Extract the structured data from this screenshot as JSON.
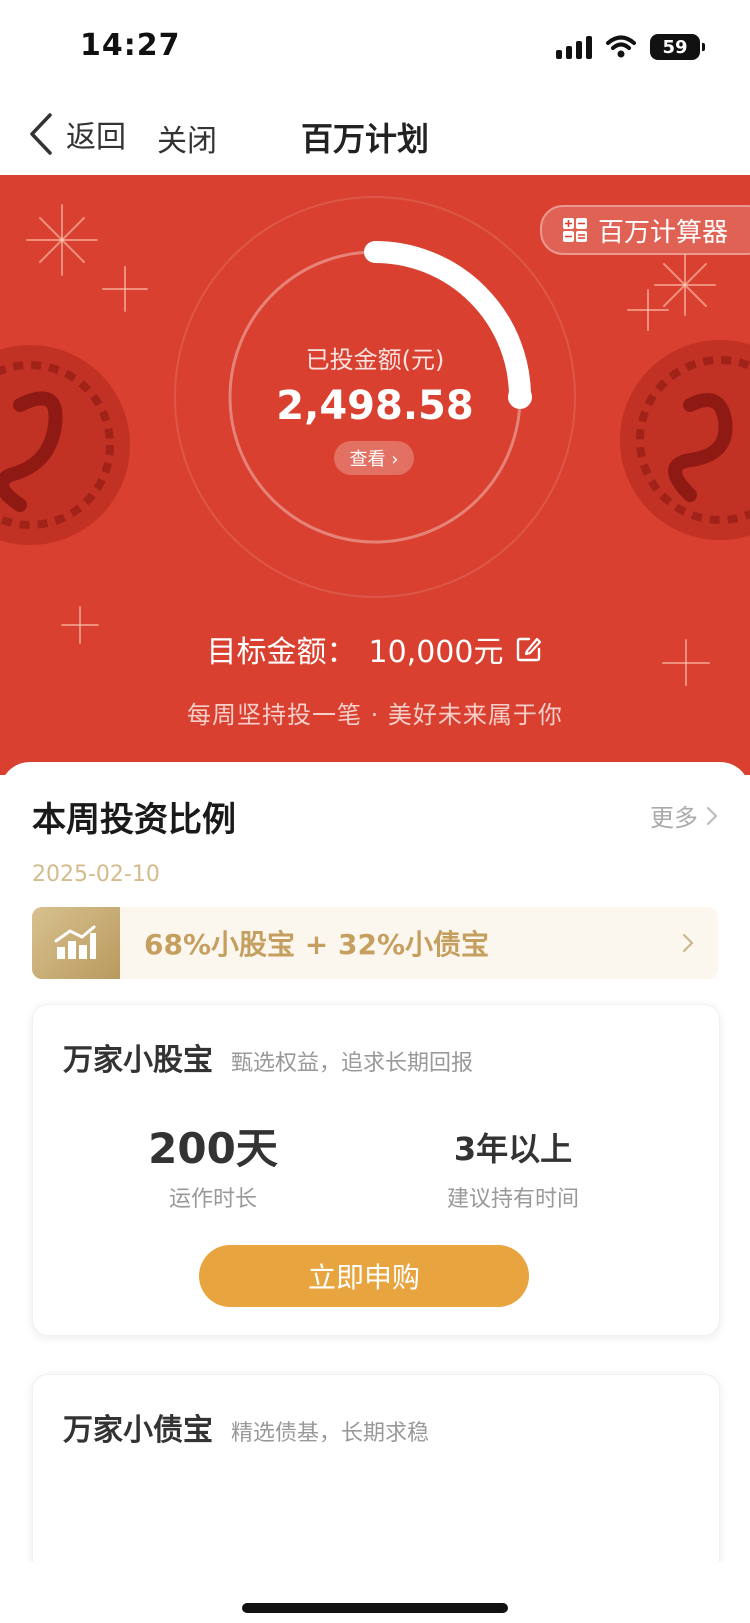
{
  "status_bar": {
    "time": "14:27",
    "battery": "59"
  },
  "nav": {
    "back_label": "返回",
    "close_label": "关闭",
    "title": "百万计划"
  },
  "hero": {
    "background_color": "#d9402f",
    "calculator_label": "百万计算器",
    "invested_label": "已投金额(元)",
    "invested_value": "2,498.58",
    "view_label": "查看 ›",
    "progress_fraction": 0.25,
    "target_label": "目标金额：",
    "target_value": "10,000元",
    "slogan": "每周坚持投一笔 · 美好未来属于你"
  },
  "weekly": {
    "title": "本周投资比例",
    "more_label": "更多",
    "date": "2025-02-10",
    "ratio_text": "68%小股宝 + 32%小债宝"
  },
  "funds": [
    {
      "name": "万家小股宝",
      "desc": "甄选权益，追求长期回报",
      "stat1_value": "200天",
      "stat1_label": "运作时长",
      "stat2_value": "3年以上",
      "stat2_label": "建议持有时间",
      "button_label": "立即申购"
    },
    {
      "name": "万家小债宝",
      "desc": "精选债基，长期求稳"
    }
  ],
  "colors": {
    "accent": "#e8a53f",
    "gold_text": "#c59f5f",
    "hero_red": "#d9402f"
  }
}
